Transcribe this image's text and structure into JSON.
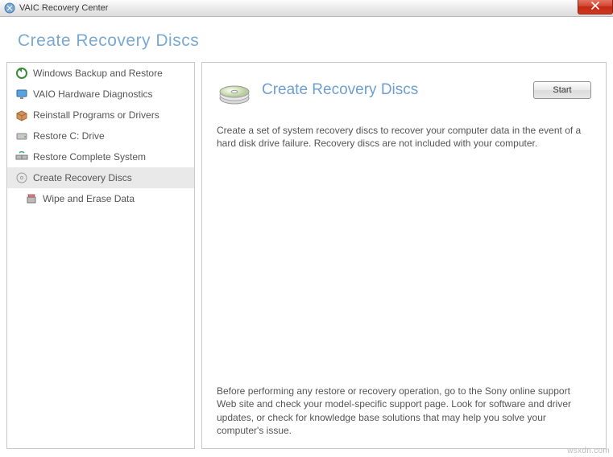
{
  "window": {
    "title": "VAIC Recovery Center"
  },
  "header": {
    "title": "Create Recovery Discs"
  },
  "sidebar": {
    "items": [
      {
        "label": "Windows Backup and Restore"
      },
      {
        "label": "VAIO Hardware Diagnostics"
      },
      {
        "label": "Reinstall Programs or Drivers"
      },
      {
        "label": "Restore C: Drive"
      },
      {
        "label": "Restore Complete System"
      },
      {
        "label": "Create Recovery Discs"
      },
      {
        "label": "Wipe and Erase Data"
      }
    ]
  },
  "content": {
    "title": "Create Recovery Discs",
    "start_label": "Start",
    "description": "Create a set of system recovery discs to recover your computer data in the event of a hard disk drive failure. Recovery discs are not included with your computer.",
    "footer": "Before performing any restore or recovery operation, go to the Sony online support Web site and check your model-specific support page. Look for software and driver updates, or check for knowledge base solutions that may help you solve your computer's issue."
  },
  "watermark": "wsxdn.com"
}
